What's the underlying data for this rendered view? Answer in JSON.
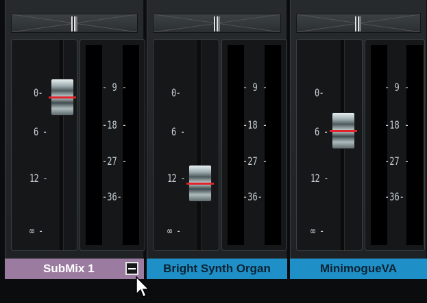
{
  "mixer": {
    "channels": [
      {
        "name": "SubMix 1",
        "fader_db": "0",
        "color": "#9c7ba1"
      },
      {
        "name": "Bright Synth Organ",
        "fader_db": "12",
        "color": "#1f8fc7"
      },
      {
        "name": "MinimogueVA",
        "fader_db": "6",
        "color": "#1f8fc7"
      }
    ],
    "fader_scale": [
      "0-",
      "6 -",
      "12 -",
      "∞ -"
    ],
    "meter_scale": [
      "- 9 -",
      "-18 -",
      "-27 -",
      "-36-"
    ],
    "minimize_label": "–"
  },
  "colors": {
    "accent_red": "#e0232b",
    "selected_label": "#9c7ba1",
    "label_blue": "#1f8fc7"
  },
  "icons": {
    "cursor": "pointer-arrow-icon",
    "minimize": "minimize-icon"
  }
}
